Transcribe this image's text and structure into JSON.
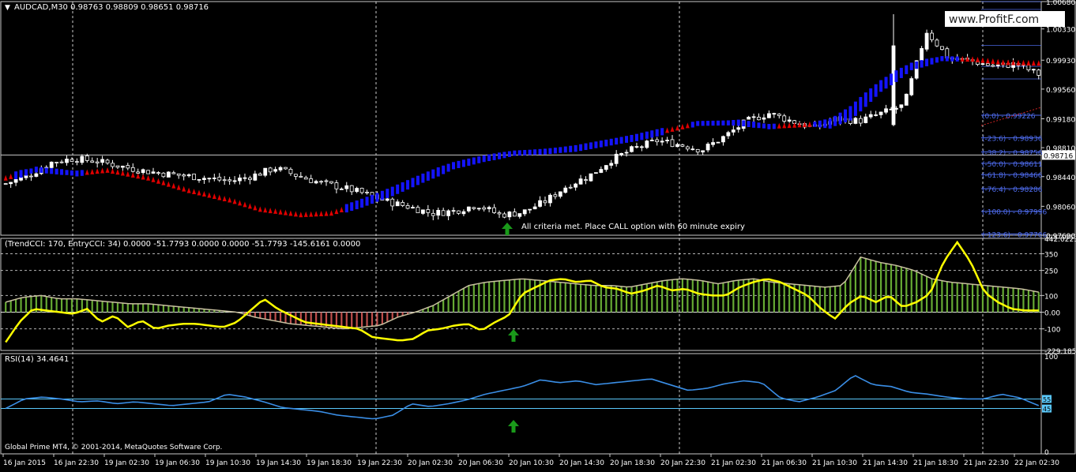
{
  "main_header": "AUDCAD,M30  0.98763 0.98809 0.98651 0.98716",
  "cci_header": "(TrendCCI: 170, EntryCCI: 34)  0.0000 -51.7793 0.0000 0.0000 -51.7793 -145.6161 0.0000",
  "rsi_header": "RSI(14) 34.4641",
  "watermark": "www.ProfitF.com",
  "copyright": "Global Prime MT4, © 2001-2014, MetaQuotes Software Corp.",
  "signal_text": "All criteria met. Place CALL option with 60 minute expiry",
  "current_price_label": "0.98716",
  "colors": {
    "background": "#000000",
    "candle_up": "#ffffff",
    "candle_down": "#000000",
    "trend_up": "#1414ff",
    "trend_down": "#e00000",
    "fib": "#4f6df0",
    "cci_line": "#ffff00",
    "cci_hist_up": "#66aa33",
    "cci_hist_down": "#c0504d",
    "rsi_line": "#3a8ee6",
    "arrow": "#1a9a1a",
    "grid": "#ffffff"
  },
  "chart_data": [
    {
      "type": "candlestick",
      "symbol": "AUDCAD",
      "timeframe": "M30",
      "ohlc_last": {
        "open": 0.98763,
        "high": 0.98809,
        "low": 0.98651,
        "close": 0.98716
      },
      "ylim": [
        0.9769,
        1.0068
      ],
      "yticks": [
        "1.00680",
        "1.00330",
        "0.99930",
        "0.99560",
        "0.99180",
        "0.98810",
        "0.98440",
        "0.98060",
        "0.97690"
      ],
      "x_labels": [
        "16 Jan 2015",
        "16 Jan 22:30",
        "19 Jan 02:30",
        "19 Jan 06:30",
        "19 Jan 10:30",
        "19 Jan 14:30",
        "19 Jan 18:30",
        "19 Jan 22:30",
        "20 Jan 02:30",
        "20 Jan 06:30",
        "20 Jan 10:30",
        "20 Jan 14:30",
        "20 Jan 18:30",
        "20 Jan 22:30",
        "21 Jan 02:30",
        "21 Jan 06:30",
        "21 Jan 10:30",
        "21 Jan 14:30",
        "21 Jan 18:30",
        "21 Jan 22:30",
        "22 Jan 02:30"
      ],
      "close_path": [
        0.9835,
        0.9845,
        0.9862,
        0.9867,
        0.9864,
        0.9858,
        0.9852,
        0.9848,
        0.9845,
        0.9842,
        0.9838,
        0.9845,
        0.9855,
        0.9845,
        0.9836,
        0.983,
        0.9822,
        0.9812,
        0.9805,
        0.9797,
        0.98,
        0.9808,
        0.9795,
        0.9798,
        0.9812,
        0.9832,
        0.9845,
        0.9866,
        0.988,
        0.989,
        0.9885,
        0.9878,
        0.9895,
        0.9915,
        0.9925,
        0.9915,
        0.9906,
        0.9918,
        0.9915,
        0.9925,
        0.9935,
        1.003,
        0.9995,
        0.9992,
        0.9985,
        0.9988,
        0.9975
      ],
      "trend_line": {
        "points": [
          [
            0,
            0.9842
          ],
          [
            6,
            0.9853
          ],
          [
            14,
            0.9848
          ],
          [
            20,
            0.9852
          ],
          [
            28,
            0.9842
          ],
          [
            36,
            0.9826
          ],
          [
            44,
            0.9814
          ],
          [
            50,
            0.9802
          ],
          [
            58,
            0.9795
          ],
          [
            64,
            0.9797
          ],
          [
            70,
            0.981
          ],
          [
            76,
            0.9825
          ],
          [
            82,
            0.9842
          ],
          [
            88,
            0.9858
          ],
          [
            94,
            0.9867
          ],
          [
            100,
            0.9874
          ],
          [
            106,
            0.9876
          ],
          [
            112,
            0.988
          ],
          [
            118,
            0.9887
          ],
          [
            124,
            0.9894
          ],
          [
            130,
            0.9903
          ],
          [
            136,
            0.9912
          ],
          [
            144,
            0.9913
          ],
          [
            150,
            0.9908
          ],
          [
            156,
            0.991
          ],
          [
            162,
            0.9912
          ],
          [
            166,
            0.9925
          ],
          [
            172,
            0.996
          ],
          [
            178,
            0.9985
          ],
          [
            184,
            0.9995
          ],
          [
            190,
            0.9994
          ],
          [
            196,
            0.999
          ],
          [
            203,
            0.9989
          ]
        ],
        "down_ranges": [
          [
            0,
            1
          ],
          [
            16,
            66
          ],
          [
            130,
            134
          ],
          [
            152,
            158
          ],
          [
            188,
            203
          ]
        ]
      },
      "fib_levels": [
        {
          "label": "(0.0) - 0.99226",
          "value": 0.99226
        },
        {
          "label": "(-23.6) - 0.98936",
          "value": 0.98936
        },
        {
          "label": "(-38.2) - 0.98756",
          "value": 0.98756
        },
        {
          "label": "(-50.0) - 0.98611",
          "value": 0.98611
        },
        {
          "label": "(-61.8) - 0.98466",
          "value": 0.98466
        },
        {
          "label": "(-76.4) - 0.98286",
          "value": 0.98286
        },
        {
          "label": "(-100.0) - 0.97996",
          "value": 0.97996
        },
        {
          "label": "(-123.6) - 0.97706",
          "value": 0.97706
        }
      ],
      "current_price": 0.98716
    },
    {
      "type": "line",
      "name": "TrendCCI / EntryCCI",
      "ylim": [
        -229.1859,
        442.0223
      ],
      "yticks": [
        "442.0223",
        "350",
        "250",
        "100",
        "0.00",
        "-100",
        "-229.1859"
      ],
      "entry_cci": [
        -180,
        -60,
        20,
        10,
        0,
        -10,
        20,
        -60,
        -20,
        -90,
        -50,
        -100,
        -80,
        -70,
        -70,
        -80,
        -90,
        -60,
        10,
        80,
        20,
        -20,
        -60,
        -70,
        -80,
        -90,
        -100,
        -150,
        -160,
        -170,
        -160,
        -110,
        -100,
        -80,
        -70,
        -110,
        -60,
        -20,
        110,
        150,
        190,
        200,
        180,
        190,
        150,
        140,
        110,
        130,
        160,
        130,
        140,
        110,
        100,
        100,
        150,
        180,
        200,
        180,
        140,
        100,
        20,
        -40,
        50,
        100,
        60,
        100,
        30,
        60,
        110,
        300,
        420,
        300,
        120,
        60,
        20,
        10,
        10
      ],
      "trend_cci": [
        60,
        90,
        100,
        80,
        80,
        70,
        60,
        50,
        50,
        40,
        30,
        20,
        10,
        0,
        -30,
        -50,
        -70,
        -80,
        -90,
        -100,
        -90,
        -80,
        -30,
        0,
        40,
        100,
        160,
        180,
        190,
        200,
        190,
        180,
        170,
        160,
        160,
        150,
        170,
        190,
        200,
        190,
        170,
        190,
        200,
        180,
        170,
        160,
        150,
        160,
        330,
        300,
        280,
        250,
        200,
        180,
        170,
        160,
        150,
        140,
        120
      ],
      "levels": [
        350,
        250,
        100,
        0,
        -100
      ]
    },
    {
      "type": "line",
      "name": "RSI(14)",
      "value": 34.4641,
      "ylim": [
        0,
        100
      ],
      "yticks": [
        "100",
        "55",
        "45",
        "0"
      ],
      "values": [
        45,
        55,
        57,
        55,
        52,
        53,
        50,
        52,
        50,
        48,
        50,
        52,
        60,
        57,
        52,
        46,
        44,
        42,
        38,
        36,
        34,
        38,
        50,
        47,
        50,
        54,
        60,
        64,
        68,
        75,
        72,
        74,
        70,
        72,
        74,
        76,
        70,
        64,
        66,
        71,
        74,
        72,
        56,
        52,
        57,
        64,
        80,
        70,
        68,
        62,
        60,
        57,
        55,
        55,
        60,
        56,
        48
      ],
      "levels": [
        55,
        45
      ]
    }
  ]
}
